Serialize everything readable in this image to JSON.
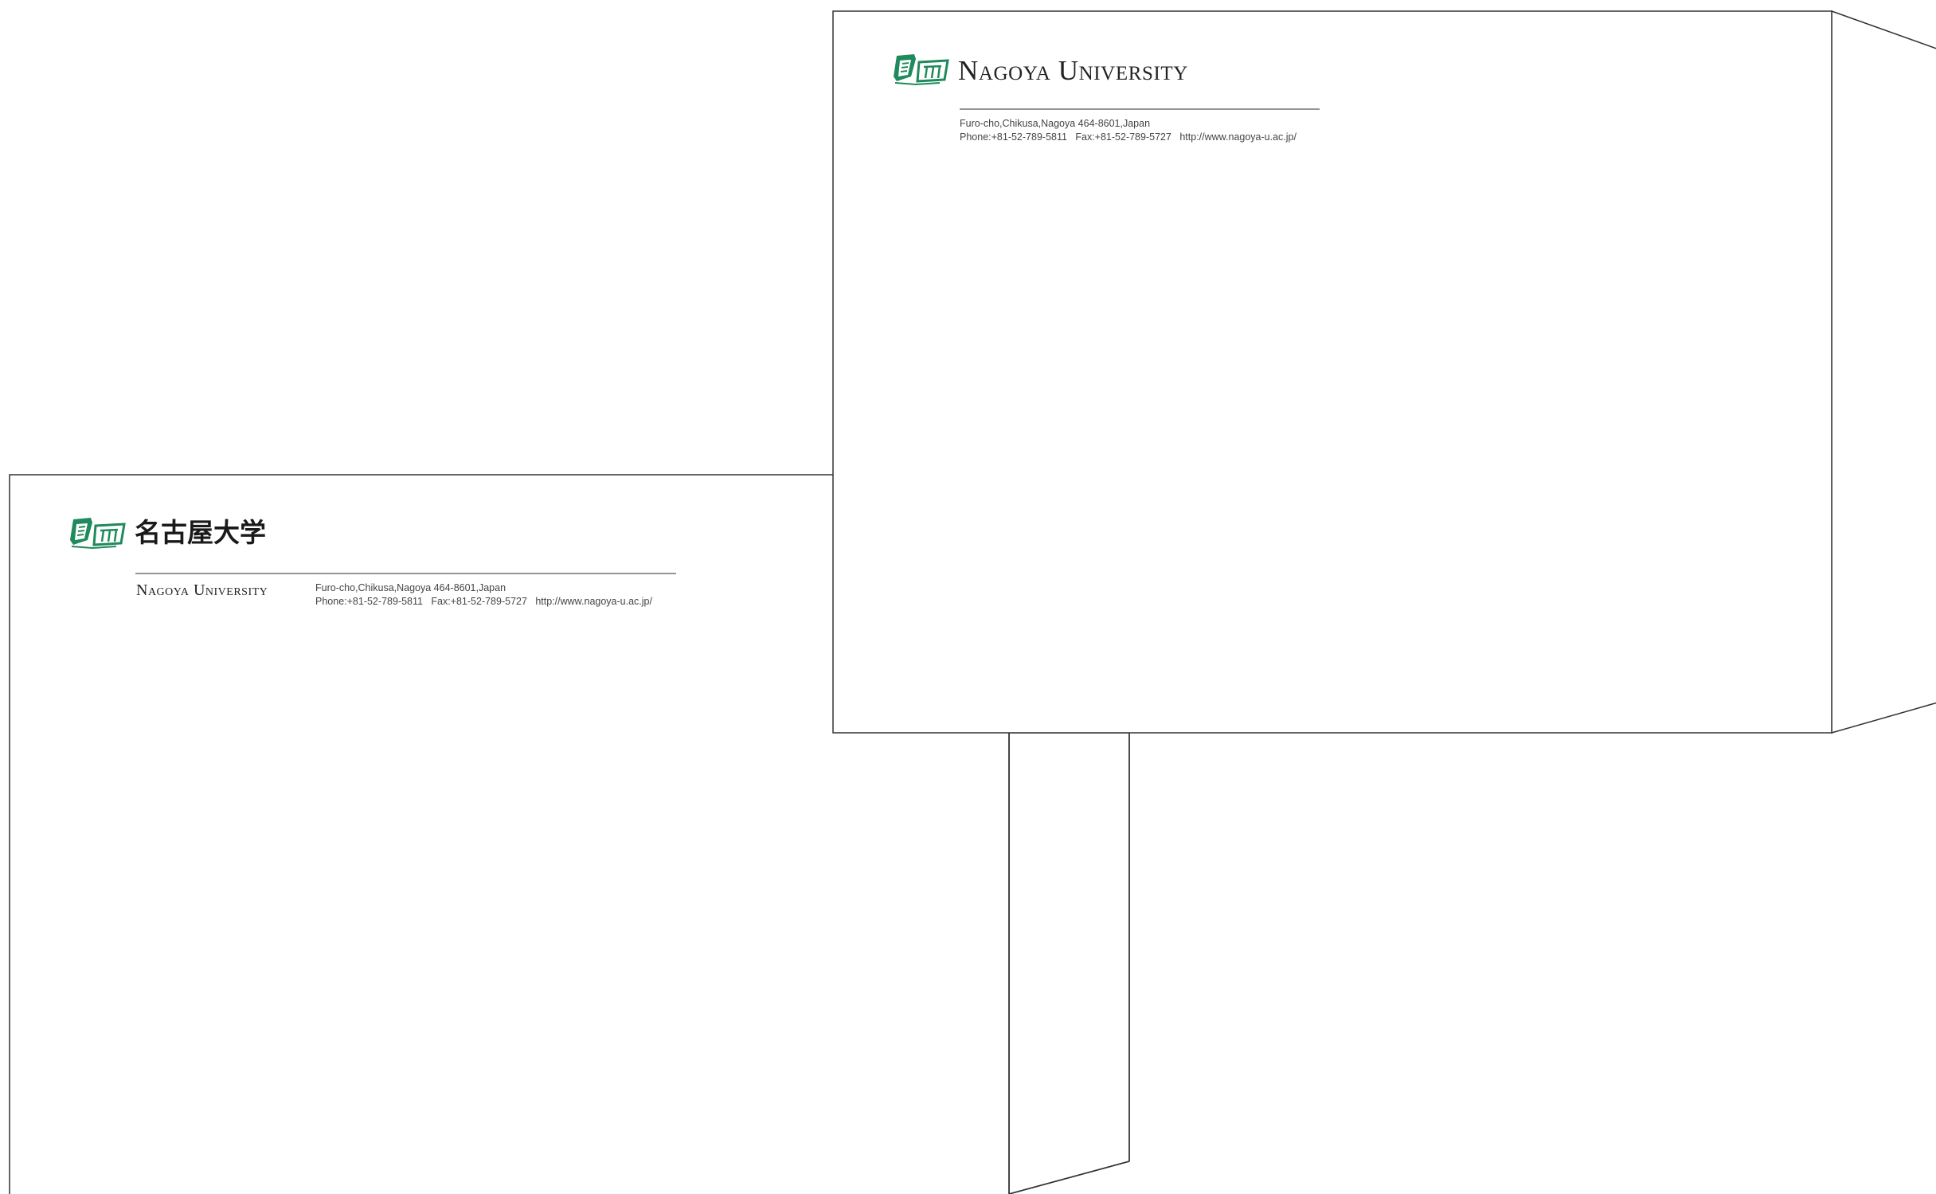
{
  "envelope_front": {
    "logo_alt": "Nagoya University emblem",
    "name_japanese": "名古屋大学",
    "name_english": "Nagoya University",
    "address_line": "Furo-cho,Chikusa,Nagoya 464-8601,Japan",
    "contact_line": "Phone:+81-52-789-5811   Fax:+81-52-789-5727   http://www.nagoya-u.ac.jp/"
  },
  "envelope_back": {
    "logo_alt": "Nagoya University emblem",
    "name_english": "Nagoya University",
    "address_line": "Furo-cho,Chikusa,Nagoya 464-8601,Japan",
    "contact_line": "Phone:+81-52-789-5811   Fax:+81-52-789-5727   http://www.nagoya-u.ac.jp/"
  },
  "colors": {
    "brand_green": "#1f8a5b",
    "outline": "#333333",
    "paper": "#ffffff"
  }
}
